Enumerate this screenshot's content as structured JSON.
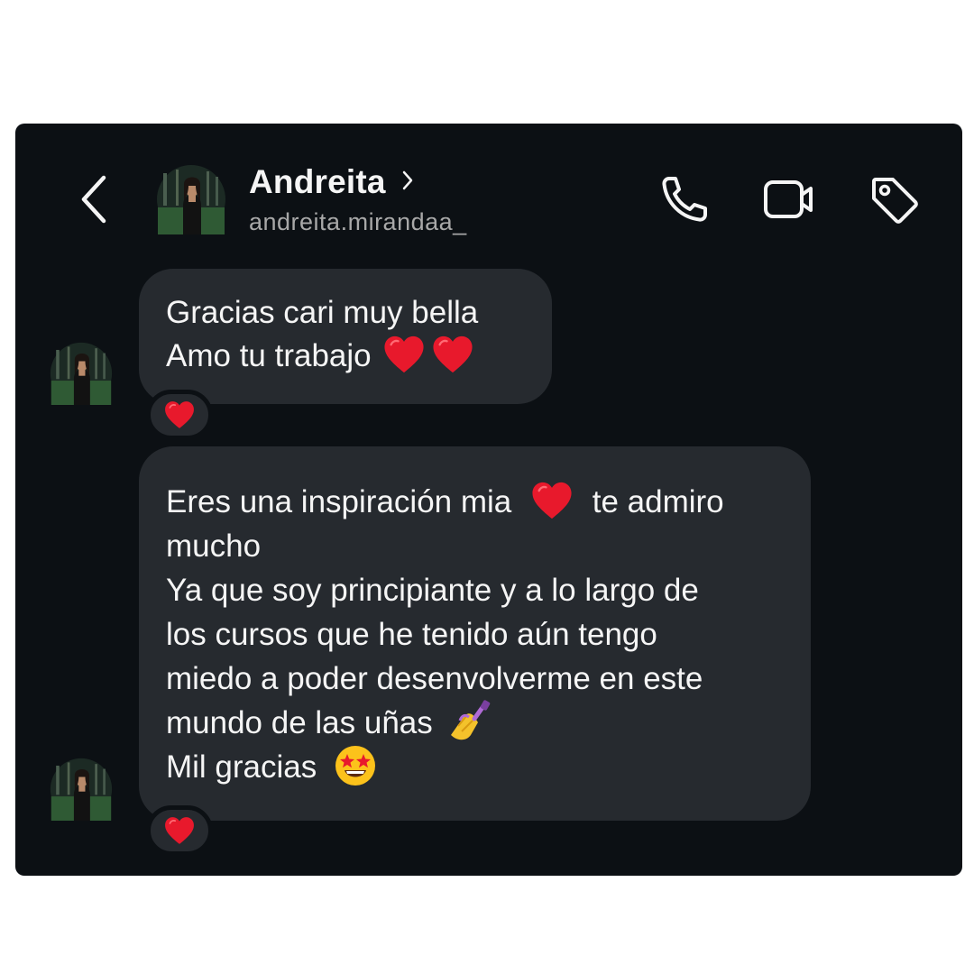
{
  "header": {
    "contact_name": "Andreita",
    "username": "andreita.mirandaa_",
    "icons": [
      "back-chevron-icon",
      "chevron-right-icon",
      "phone-icon",
      "video-camera-icon",
      "tag-icon"
    ]
  },
  "messages": [
    {
      "lines": [
        "Gracias cari muy bella",
        "Amo tu trabajo"
      ],
      "emoji": [
        "red-heart",
        "red-heart"
      ],
      "reaction": "red-heart"
    },
    {
      "lines": [
        "Eres una inspiración mia",
        "te admiro",
        "mucho",
        "Ya que soy principiante y a lo largo de",
        "los cursos que he tenido aún tengo",
        "miedo a poder desenvolverme en este",
        "mundo de las uñas",
        "Mil gracias"
      ],
      "emoji": [
        "red-heart",
        "nail-polish",
        "star-struck"
      ],
      "reaction": "red-heart"
    }
  ],
  "colors": {
    "background": "#0c1014",
    "bubble": "#262a2f",
    "text": "#f5f5f5",
    "muted": "#a8a8a8",
    "heart": "#e8192c"
  }
}
